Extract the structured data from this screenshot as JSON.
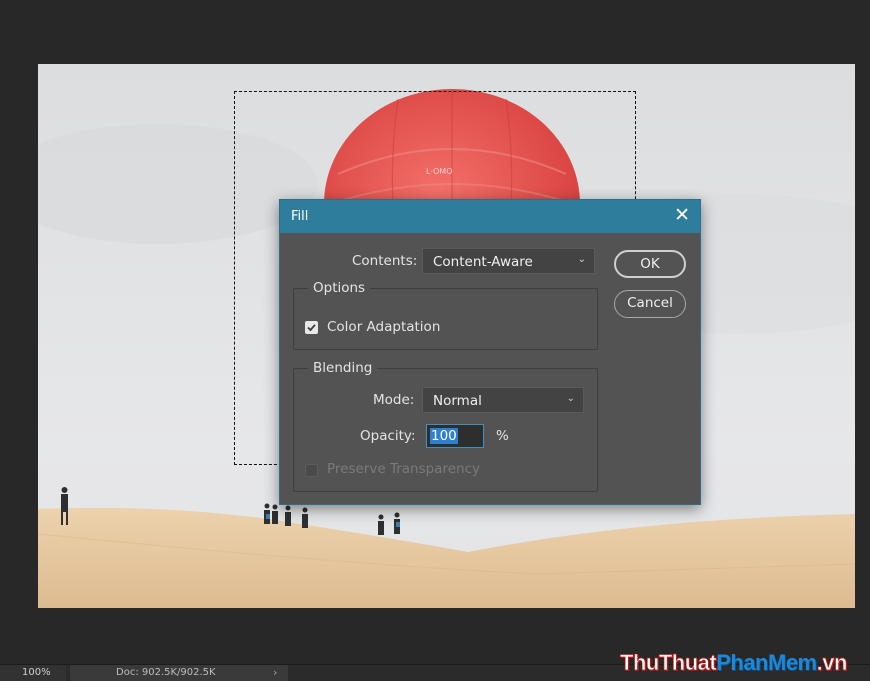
{
  "dialog": {
    "title": "Fill",
    "contents_label": "Contents:",
    "contents_value": "Content-Aware",
    "ok_label": "OK",
    "cancel_label": "Cancel",
    "options_legend": "Options",
    "color_adaptation_label": "Color Adaptation",
    "color_adaptation_checked": true,
    "blending_legend": "Blending",
    "mode_label": "Mode:",
    "mode_value": "Normal",
    "opacity_label": "Opacity:",
    "opacity_value": "100",
    "opacity_unit": "%",
    "preserve_transparency_label": "Preserve Transparency",
    "preserve_transparency_enabled": false,
    "colors": {
      "titlebar": "#2f7d9c",
      "body": "#535353",
      "selected_text": "#2f7fd0"
    }
  },
  "canvas": {
    "balloon_text": "L·OMO",
    "colors": {
      "background": "#282828",
      "sky": "#e2e3e5",
      "sand": "#e6c9a2",
      "balloon": "#e8524e"
    }
  },
  "statusbar": {
    "zoom": "100%",
    "doc_info": "Doc: 902.5K/902.5K",
    "arrow": "›"
  },
  "watermark": {
    "part1": "ThuThuat",
    "part2": "PhanMem",
    "part3": ".vn"
  }
}
